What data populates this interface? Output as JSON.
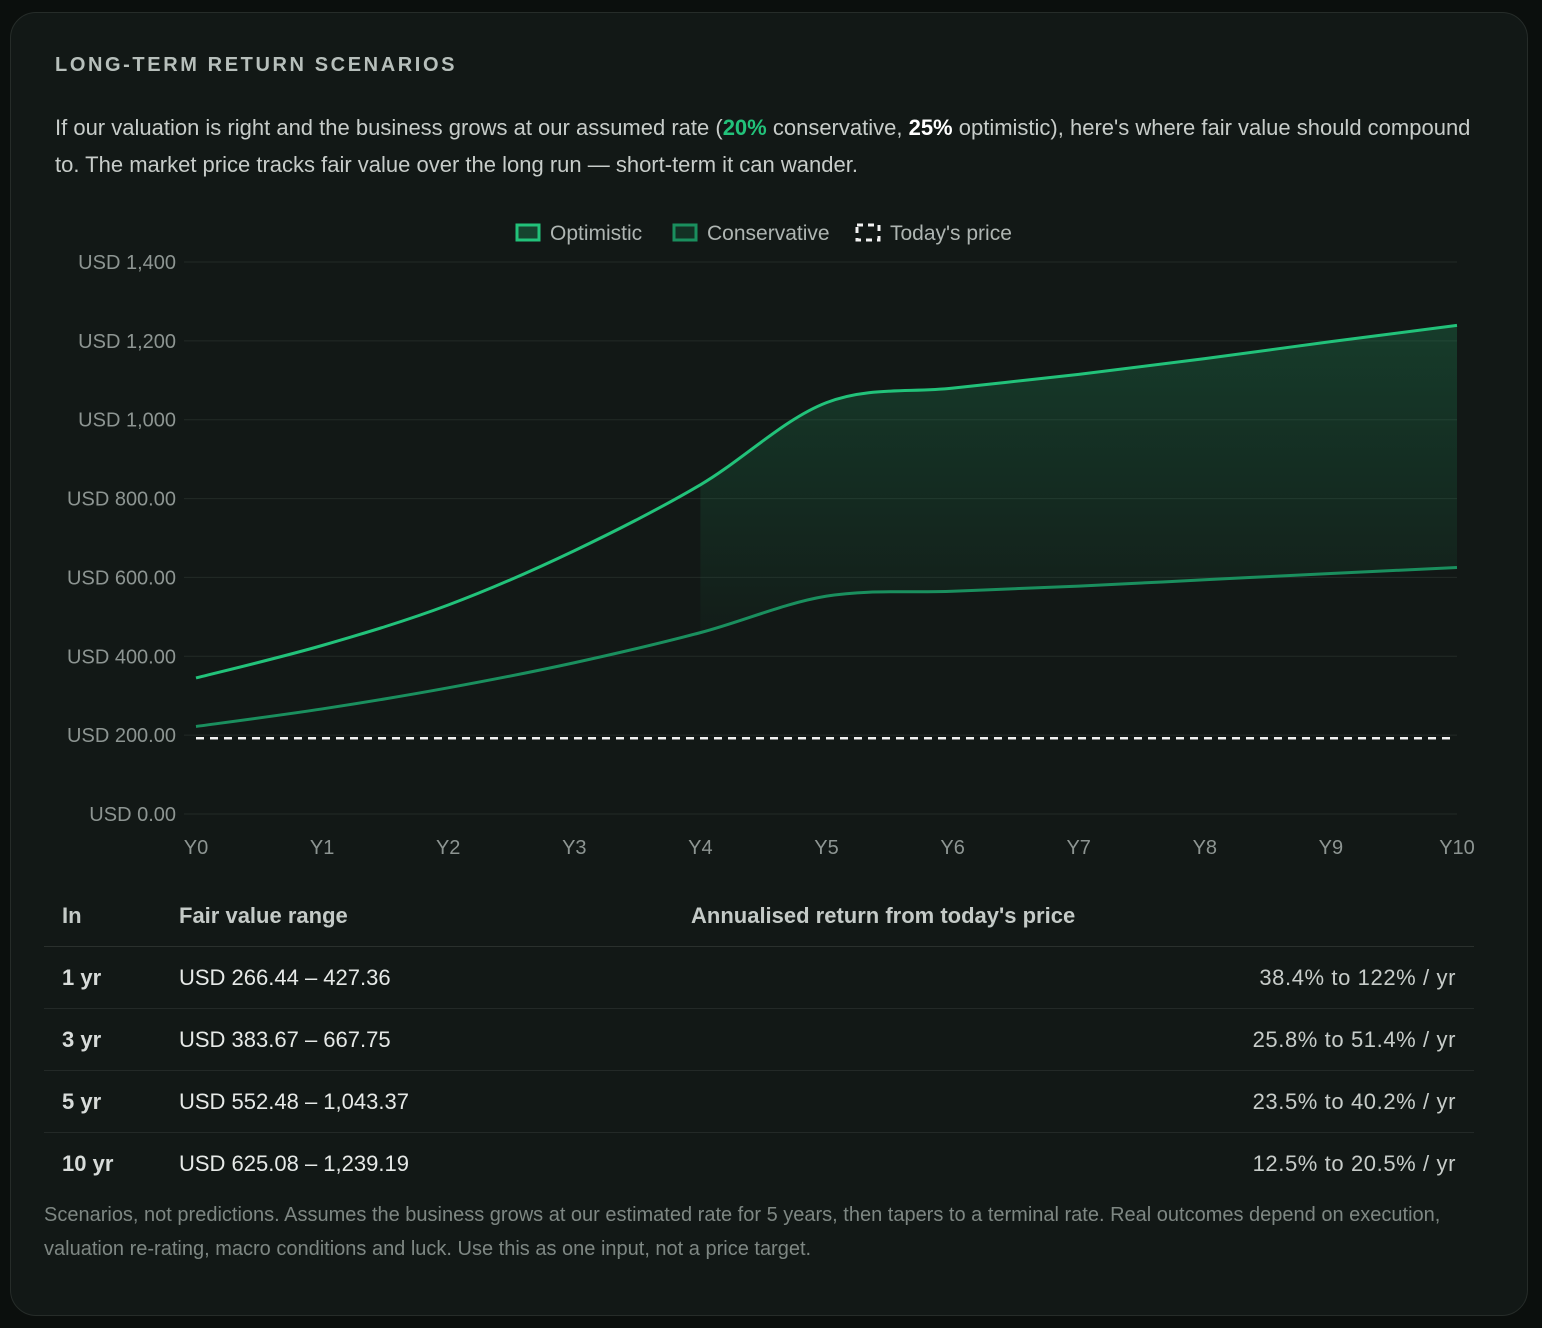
{
  "heading": "LONG-TERM RETURN SCENARIOS",
  "intro": {
    "part1": "If our valuation is right and the business grows at our assumed rate (",
    "conservative_rate": "20%",
    "part2": " conservative, ",
    "optimistic_rate": "25%",
    "part3": " optimistic), here's where fair value should compound to. The market price tracks fair value over the long run — short-term it can wander."
  },
  "chart_data": {
    "type": "line",
    "categories": [
      "Y0",
      "Y1",
      "Y2",
      "Y3",
      "Y4",
      "Y5",
      "Y6",
      "Y7",
      "Y8",
      "Y9",
      "Y10"
    ],
    "series": [
      {
        "name": "Optimistic",
        "color": "#22c27a",
        "values": [
          345,
          427.36,
          530,
          667.75,
          835,
          1043.37,
          1080,
          1115,
          1155,
          1198,
          1239.19
        ]
      },
      {
        "name": "Conservative",
        "color": "#1a8f5e",
        "values": [
          222,
          266.44,
          320,
          383.67,
          460,
          552.48,
          565,
          578,
          594,
          610,
          625.08
        ]
      },
      {
        "name": "Today's price",
        "color": "#f2f2f2",
        "dashed": true,
        "values": [
          192,
          192,
          192,
          192,
          192,
          192,
          192,
          192,
          192,
          192,
          192
        ]
      }
    ],
    "yticks": [
      "USD 0.00",
      "USD 200.00",
      "USD 400.00",
      "USD 600.00",
      "USD 800.00",
      "USD 1,000",
      "USD 1,200",
      "USD 1,400"
    ],
    "ylim": [
      0,
      1400
    ],
    "legend": "top-center",
    "grid": true,
    "title": "",
    "xlabel": "",
    "ylabel": ""
  },
  "table": {
    "headers": [
      "In",
      "Fair value range",
      "Annualised return from today's price",
      ""
    ],
    "rows": [
      [
        "1 yr",
        "USD 266.44 – 427.36",
        "",
        "38.4% to 122% / yr"
      ],
      [
        "3 yr",
        "USD 383.67 – 667.75",
        "",
        "25.8% to 51.4% / yr"
      ],
      [
        "5 yr",
        "USD 552.48 – 1,043.37",
        "",
        "23.5% to 40.2% / yr"
      ],
      [
        "10 yr",
        "USD 625.08 – 1,239.19",
        "",
        "12.5% to 20.5% / yr"
      ]
    ]
  },
  "footnote": "Scenarios, not predictions. Assumes the business grows at our estimated rate for 5 years, then tapers to a terminal rate. Real outcomes depend on execution, valuation re-rating, macro conditions and luck. Use this as one input, not a price target."
}
